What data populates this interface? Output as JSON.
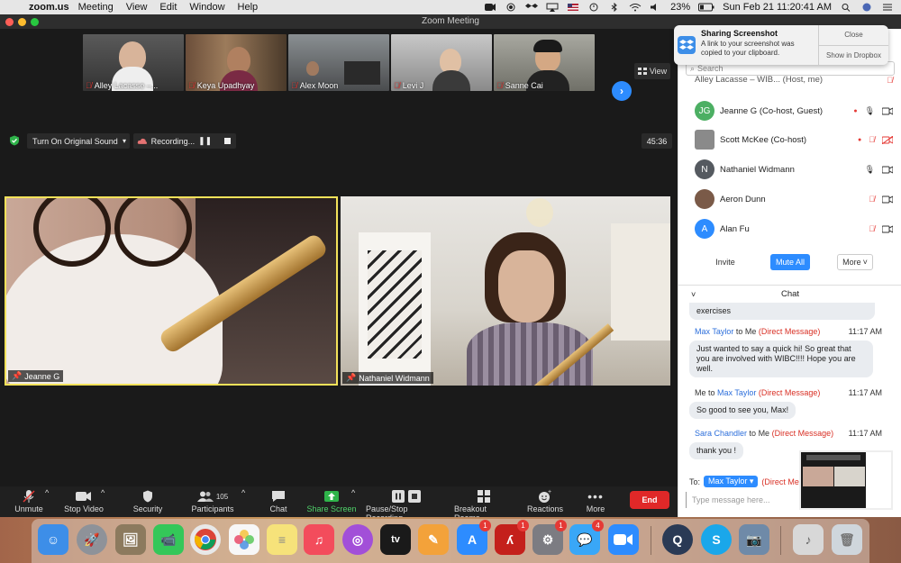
{
  "menubar": {
    "app_name": "zoom.us",
    "items": [
      "Meeting",
      "View",
      "Edit",
      "Window",
      "Help"
    ],
    "battery": "23%",
    "datetime": "Sun Feb 21  11:20:41 AM"
  },
  "window": {
    "title": "Zoom Meeting"
  },
  "thumbnails": [
    {
      "name": "Alley Lacasse –..."
    },
    {
      "name": "Keya Upadhyay"
    },
    {
      "name": "Alex Moon"
    },
    {
      "name": "Levi J"
    },
    {
      "name": "Sanne Cai"
    }
  ],
  "view_label": "View",
  "controls": {
    "original_sound": "Turn On Original Sound",
    "recording": "Recording...",
    "timer": "45:36"
  },
  "main_tiles": [
    {
      "name": "Jeanne G"
    },
    {
      "name": "Nathaniel Widmann"
    }
  ],
  "toolbar": {
    "unmute": "Unmute",
    "stop_video": "Stop Video",
    "security": "Security",
    "participants": "Participants",
    "participants_count": "105",
    "chat": "Chat",
    "share_screen": "Share Screen",
    "pause_recording": "Pause/Stop Recording",
    "breakout_rooms": "Breakout Rooms",
    "reactions": "Reactions",
    "more": "More",
    "end": "End"
  },
  "notification": {
    "title": "Sharing Screenshot",
    "body": "A link to your screenshot was copied to your clipboard.",
    "close": "Close",
    "show": "Show in Dropbox"
  },
  "panel": {
    "search_placeholder": "Search",
    "partial_row": "Alley Lacasse – WIB... (Host, me)",
    "participants": [
      {
        "initials": "JG",
        "name": "Jeanne G (Co-host, Guest)",
        "color": "#4caf63"
      },
      {
        "initials": "",
        "name": "Scott McKee (Co-host)",
        "color": "#8a8a8a"
      },
      {
        "initials": "N",
        "name": "Nathaniel Widmann",
        "color": "#555a60"
      },
      {
        "initials": "",
        "name": "Aeron Dunn",
        "color": "#7a5a48"
      },
      {
        "initials": "A",
        "name": "Alan Fu",
        "color": "#2d8cff"
      }
    ],
    "invite": "Invite",
    "mute_all": "Mute All",
    "more": "More"
  },
  "chat": {
    "title": "Chat",
    "partial_msg": "exercises",
    "messages": [
      {
        "from": "Max Taylor",
        "to": "Me",
        "dm": "(Direct Message)",
        "time": "11:17 AM",
        "text": "Just wanted to say a quick hi!  So great that you are involved with WIBC!!!!  Hope you are well."
      },
      {
        "from": "Me",
        "to": "Max Taylor",
        "dm": "(Direct Message)",
        "time": "11:17 AM",
        "text": "So good to see you, Max!"
      },
      {
        "from": "Sara Chandler",
        "to": "Me",
        "dm": "(Direct Message)",
        "time": "11:17 AM",
        "text": "thank you !"
      }
    ],
    "to_label": "To:",
    "to_value": "Max Taylor",
    "to_dm": "(Direct Me",
    "input_placeholder": "Type message here..."
  },
  "dock": {
    "items": [
      {
        "name": "finder",
        "color": "#3d8ee8"
      },
      {
        "name": "launchpad",
        "color": "#8e9299"
      },
      {
        "name": "preview",
        "color": "#8c7a5e"
      },
      {
        "name": "facetime",
        "color": "#34c759"
      },
      {
        "name": "chrome",
        "color": "#e8e8e8"
      },
      {
        "name": "photos",
        "color": "#f7f7f7"
      },
      {
        "name": "notes",
        "color": "#f6e27a"
      },
      {
        "name": "music",
        "color": "#f34c5c"
      },
      {
        "name": "podcasts",
        "color": "#a24fd8"
      },
      {
        "name": "tv",
        "color": "#1a1a1a"
      },
      {
        "name": "pages",
        "color": "#f3a23a"
      },
      {
        "name": "app-store",
        "color": "#2d8cff"
      },
      {
        "name": "acrobat",
        "color": "#c4201b"
      },
      {
        "name": "system-preferences",
        "color": "#7c7c82"
      },
      {
        "name": "messages",
        "color": "#39a7f7"
      },
      {
        "name": "zoom",
        "color": "#2d8cff"
      },
      {
        "name": "quicktime",
        "color": "#2a3a55"
      },
      {
        "name": "skype",
        "color": "#1aa7ea"
      },
      {
        "name": "image-capture",
        "color": "#6f8aa8"
      },
      {
        "name": "music-folder",
        "color": "#d8d8d8"
      },
      {
        "name": "trash",
        "color": "#cfd6dc"
      }
    ],
    "tv_label": "tv",
    "appstore_badge": "1",
    "acrobat_badge": "1",
    "sysprefs_badge": "1",
    "messages_badge": "4"
  }
}
